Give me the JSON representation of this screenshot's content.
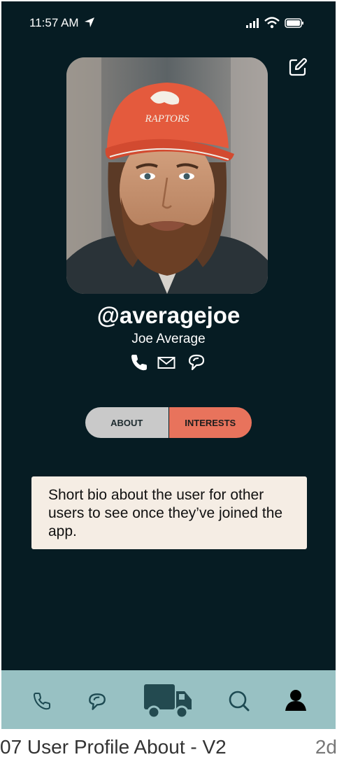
{
  "status_bar": {
    "time": "11:57 AM"
  },
  "profile": {
    "username": "@averagejoe",
    "full_name": "Joe Average",
    "photo_alt": "Profile photo",
    "hat_text": "RAPTORS"
  },
  "tabs": {
    "about_label": "ABOUT",
    "interests_label": "INTERESTS"
  },
  "bio": {
    "text": "Short bio about the user for other users to see once they’ve joined the app."
  },
  "bottom_nav": {
    "items": [
      "phone-icon",
      "chat-icon",
      "truck-icon",
      "search-icon",
      "user-icon"
    ]
  },
  "caption": {
    "title": "07 User Profile About - V2",
    "age": "2d"
  },
  "colors": {
    "background": "#061c23",
    "accent": "#e8735c",
    "tab_inactive": "#c9c9c9",
    "tabbar": "#98c1c3",
    "bio_card": "#f5ede4"
  }
}
